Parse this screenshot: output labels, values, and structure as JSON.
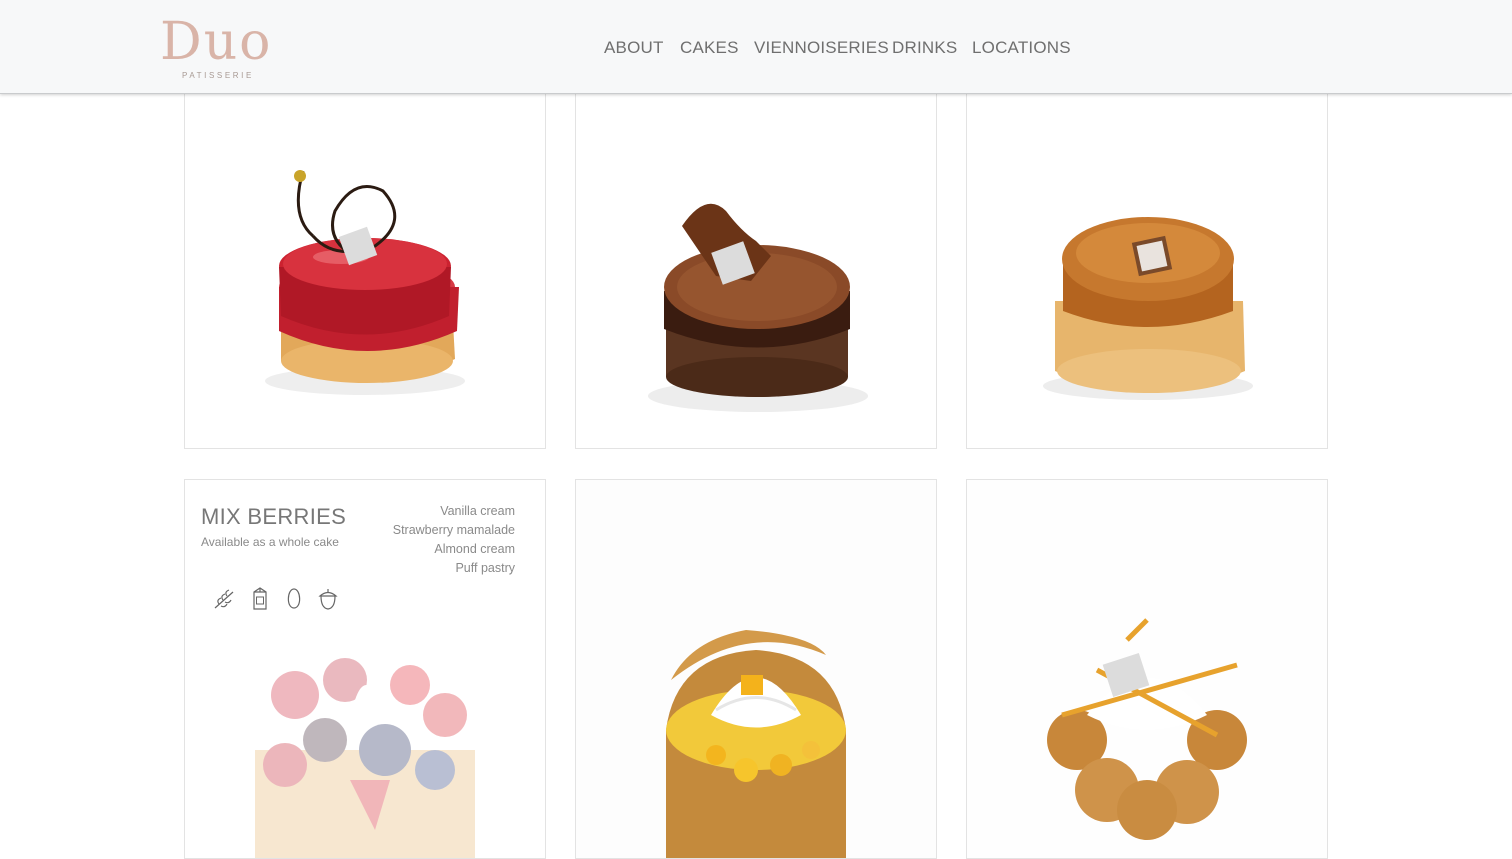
{
  "brand": {
    "name": "Duo",
    "subtitle": "PATISSERIE"
  },
  "nav": [
    {
      "label": "ABOUT"
    },
    {
      "label": "CAKES"
    },
    {
      "label": "VIENNOISERIES"
    },
    {
      "label": "DRINKS"
    },
    {
      "label": "LOCATIONS"
    }
  ],
  "cards": [
    {
      "kind": "photo",
      "image": "red-glazed-tart"
    },
    {
      "kind": "photo",
      "image": "chocolate-tart"
    },
    {
      "kind": "photo",
      "image": "caramel-tart"
    },
    {
      "kind": "info",
      "title": "MIX BERRIES",
      "subtitle": "Available as a whole cake",
      "ingredients": [
        "Vanilla cream",
        "Strawberry mamalade",
        "Almond cream",
        "Puff pastry"
      ],
      "allergens": [
        "wheat-icon",
        "milk-icon",
        "egg-icon",
        "nut-icon"
      ],
      "image": "mixed-berries-tart"
    },
    {
      "kind": "photo",
      "image": "mango-choux"
    },
    {
      "kind": "photo",
      "image": "saint-honore"
    }
  ],
  "colors": {
    "logo": "#d9b4a8",
    "nav_text": "#6f6f6f",
    "header_bg": "#f7f8f9",
    "card_border": "#e3e3e3"
  }
}
